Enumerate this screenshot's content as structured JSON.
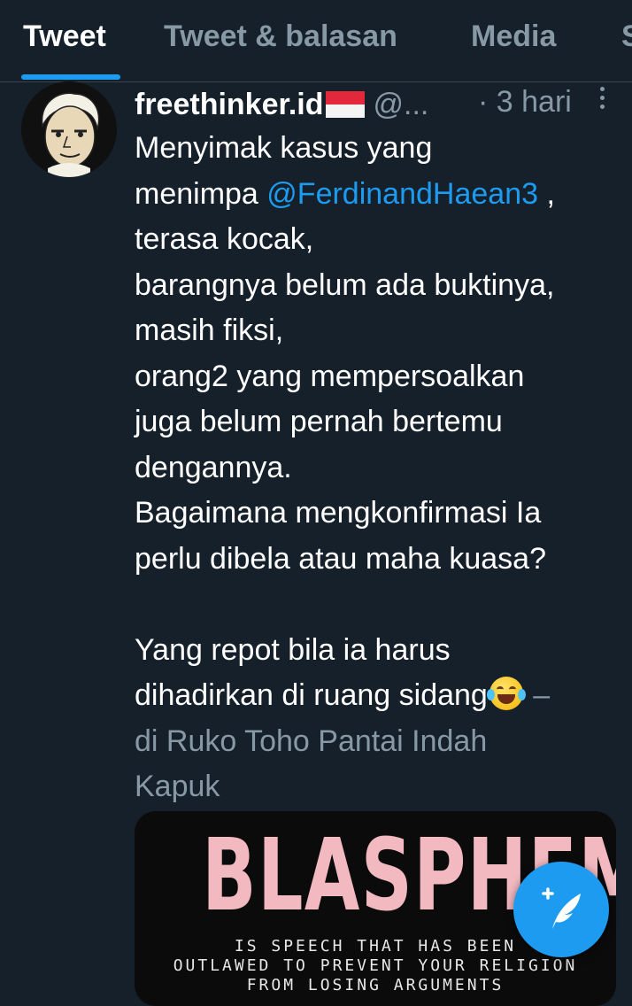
{
  "tabs": [
    "Tweet",
    "Tweet & balasan",
    "Media",
    "S"
  ],
  "tweet": {
    "name": "freethinker.id",
    "handle": "@...",
    "time": "· 3 hari",
    "lines": [
      "Menyimak kasus yang",
      "menimpa",
      "terasa kocak,",
      "barangnya belum ada buktinya,",
      "masih fiksi,",
      "orang2 yang mempersoalkan",
      "juga belum pernah bertemu",
      "dengannya.",
      "Bagaimana mengkonfirmasi Ia",
      "perlu dibela atau maha kuasa?",
      "",
      "Yang repot bila ia harus",
      "dihadirkan di ruang sidang",
      "di Ruko Toho Pantai Indah",
      "Kapuk"
    ],
    "mention": "@FerdinandHaean3",
    "mention_suffix": " ,",
    "location_prefix": " –",
    "media": {
      "title": "BLASPHEMY",
      "line1": "IS SPEECH THAT HAS BEEN",
      "line2": "OUTLAWED TO PREVENT YOUR RELIGION",
      "line3": "FROM LOSING ARGUMENTS"
    }
  },
  "colors": {
    "background": "#15202b",
    "accent": "#1d9bf0",
    "secondary_text": "#8899a6"
  },
  "icons": [
    "avatar-caricature",
    "indonesia-flag-icon",
    "more-options-icon",
    "laughing-tears-emoji-icon",
    "compose-tweet-icon"
  ]
}
